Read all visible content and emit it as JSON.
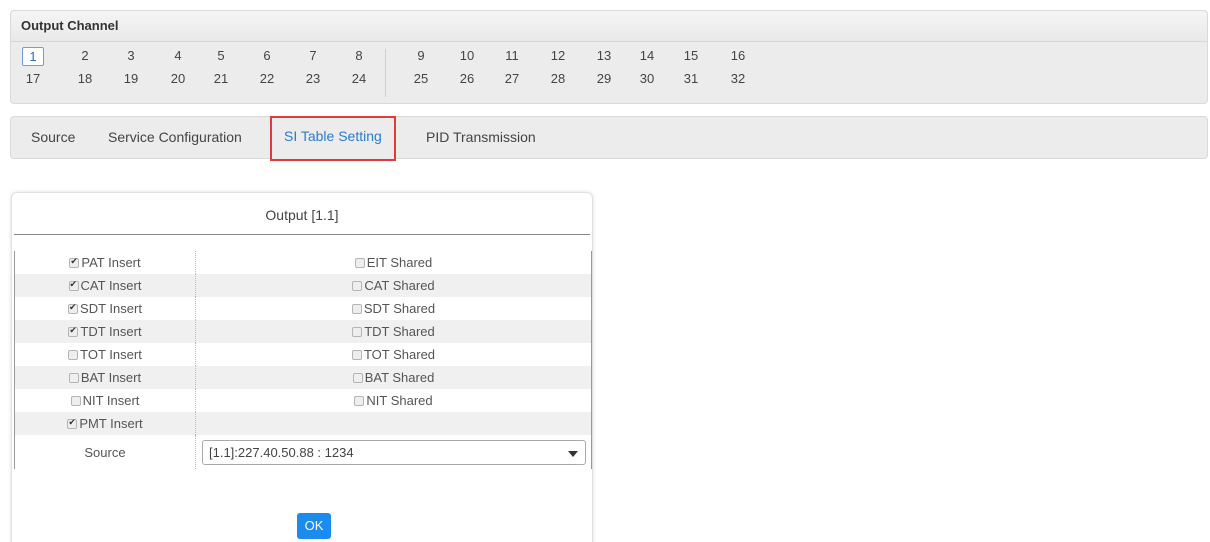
{
  "output_channel": {
    "title": "Output Channel",
    "row1_left": [
      "1",
      "2",
      "3",
      "4",
      "5",
      "6",
      "7",
      "8"
    ],
    "row1_right": [
      "9",
      "10",
      "11",
      "12",
      "13",
      "14",
      "15",
      "16"
    ],
    "row2_left": [
      "17",
      "18",
      "19",
      "20",
      "21",
      "22",
      "23",
      "24"
    ],
    "row2_right": [
      "25",
      "26",
      "27",
      "28",
      "29",
      "30",
      "31",
      "32"
    ],
    "selected": "1"
  },
  "tabs": [
    {
      "label": "Source"
    },
    {
      "label": "Service Configuration"
    },
    {
      "label": "SI Table Setting",
      "active": true
    },
    {
      "label": "PID Transmission"
    }
  ],
  "output": {
    "title": "Output  [1.1]",
    "rows": [
      {
        "insert": "PAT Insert",
        "insert_checked": true,
        "shared": "EIT Shared",
        "shared_checked": false
      },
      {
        "insert": "CAT Insert",
        "insert_checked": true,
        "shared": "CAT Shared",
        "shared_checked": false
      },
      {
        "insert": "SDT Insert",
        "insert_checked": true,
        "shared": "SDT Shared",
        "shared_checked": false
      },
      {
        "insert": "TDT Insert",
        "insert_checked": true,
        "shared": "TDT Shared",
        "shared_checked": false
      },
      {
        "insert": "TOT Insert",
        "insert_checked": false,
        "shared": "TOT Shared",
        "shared_checked": false
      },
      {
        "insert": "BAT Insert",
        "insert_checked": false,
        "shared": "BAT Shared",
        "shared_checked": false
      },
      {
        "insert": "NIT Insert",
        "insert_checked": false,
        "shared": "NIT Shared",
        "shared_checked": false
      },
      {
        "insert": "PMT Insert",
        "insert_checked": true,
        "shared": "",
        "shared_checked": false
      }
    ],
    "source_label": "Source",
    "source_value": "[1.1]:227.40.50.88 : 1234",
    "ok_label": "OK"
  },
  "colors": {
    "accent": "#1a8cf0",
    "highlight": "#e23a3a",
    "active_tab": "#2a7ad8"
  }
}
